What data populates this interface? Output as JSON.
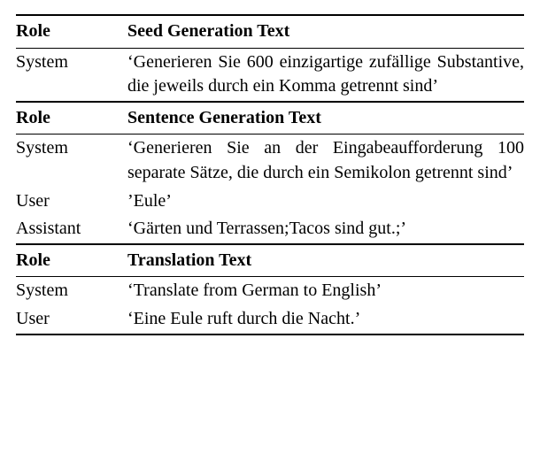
{
  "sections": [
    {
      "heading_role": "Role",
      "heading_text": "Seed Generation Text",
      "rows": [
        {
          "role": "System",
          "text": "‘Generieren Sie 600 einzigartige zufällige Substantive, die jeweils durch ein Komma getrennt sind’"
        }
      ]
    },
    {
      "heading_role": "Role",
      "heading_text": "Sentence Generation Text",
      "rows": [
        {
          "role": "System",
          "text": "‘Generieren Sie an der Eingabeauf­forderung 100 separate Sätze, die durch ein Semikolon getrennt sind’"
        },
        {
          "role": "User",
          "text": "’Eule’"
        },
        {
          "role": "Assistant",
          "text": "‘Gärten und Terrassen;Tacos sind gut.;’"
        }
      ]
    },
    {
      "heading_role": "Role",
      "heading_text": "Translation Text",
      "rows": [
        {
          "role": "System",
          "text": "‘Translate from German to English’"
        },
        {
          "role": "User",
          "text": "‘Eine Eule ruft durch die Nacht.’"
        }
      ]
    }
  ]
}
